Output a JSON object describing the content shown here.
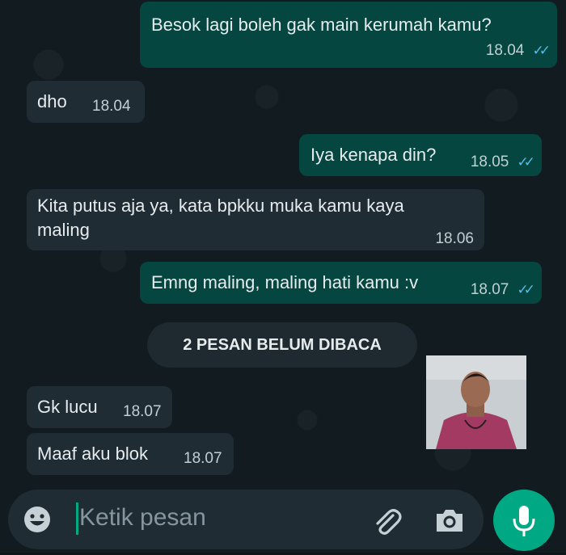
{
  "messages": [
    {
      "text": "Besok lagi boleh gak main kerumah kamu?",
      "time": "18.04",
      "ticks": "✓✓"
    },
    {
      "text": "dho",
      "time": "18.04"
    },
    {
      "text": "Iya kenapa din?",
      "time": "18.05",
      "ticks": "✓✓"
    },
    {
      "text": "Kita putus aja ya, kata bpkku muka kamu kaya",
      "text2": "maling",
      "time": "18.06"
    },
    {
      "text": "Emng maling, maling hati kamu :v",
      "time": "18.07",
      "ticks": "✓✓"
    },
    {
      "text": "Gk lucu",
      "time": "18.07"
    },
    {
      "text": "Maaf aku blok",
      "time": "18.07"
    }
  ],
  "unread_banner": "2 PESAN BELUM DIBACA",
  "composer": {
    "placeholder": "Ketik pesan"
  },
  "icons": {
    "emoji": "emoji-icon",
    "attach": "paperclip-icon",
    "camera": "camera-icon",
    "mic": "microphone-icon"
  },
  "colors": {
    "outgoing_bubble": "#054740",
    "incoming_bubble": "#1f2c33",
    "read_ticks": "#53bdeb",
    "accent": "#00a884"
  }
}
